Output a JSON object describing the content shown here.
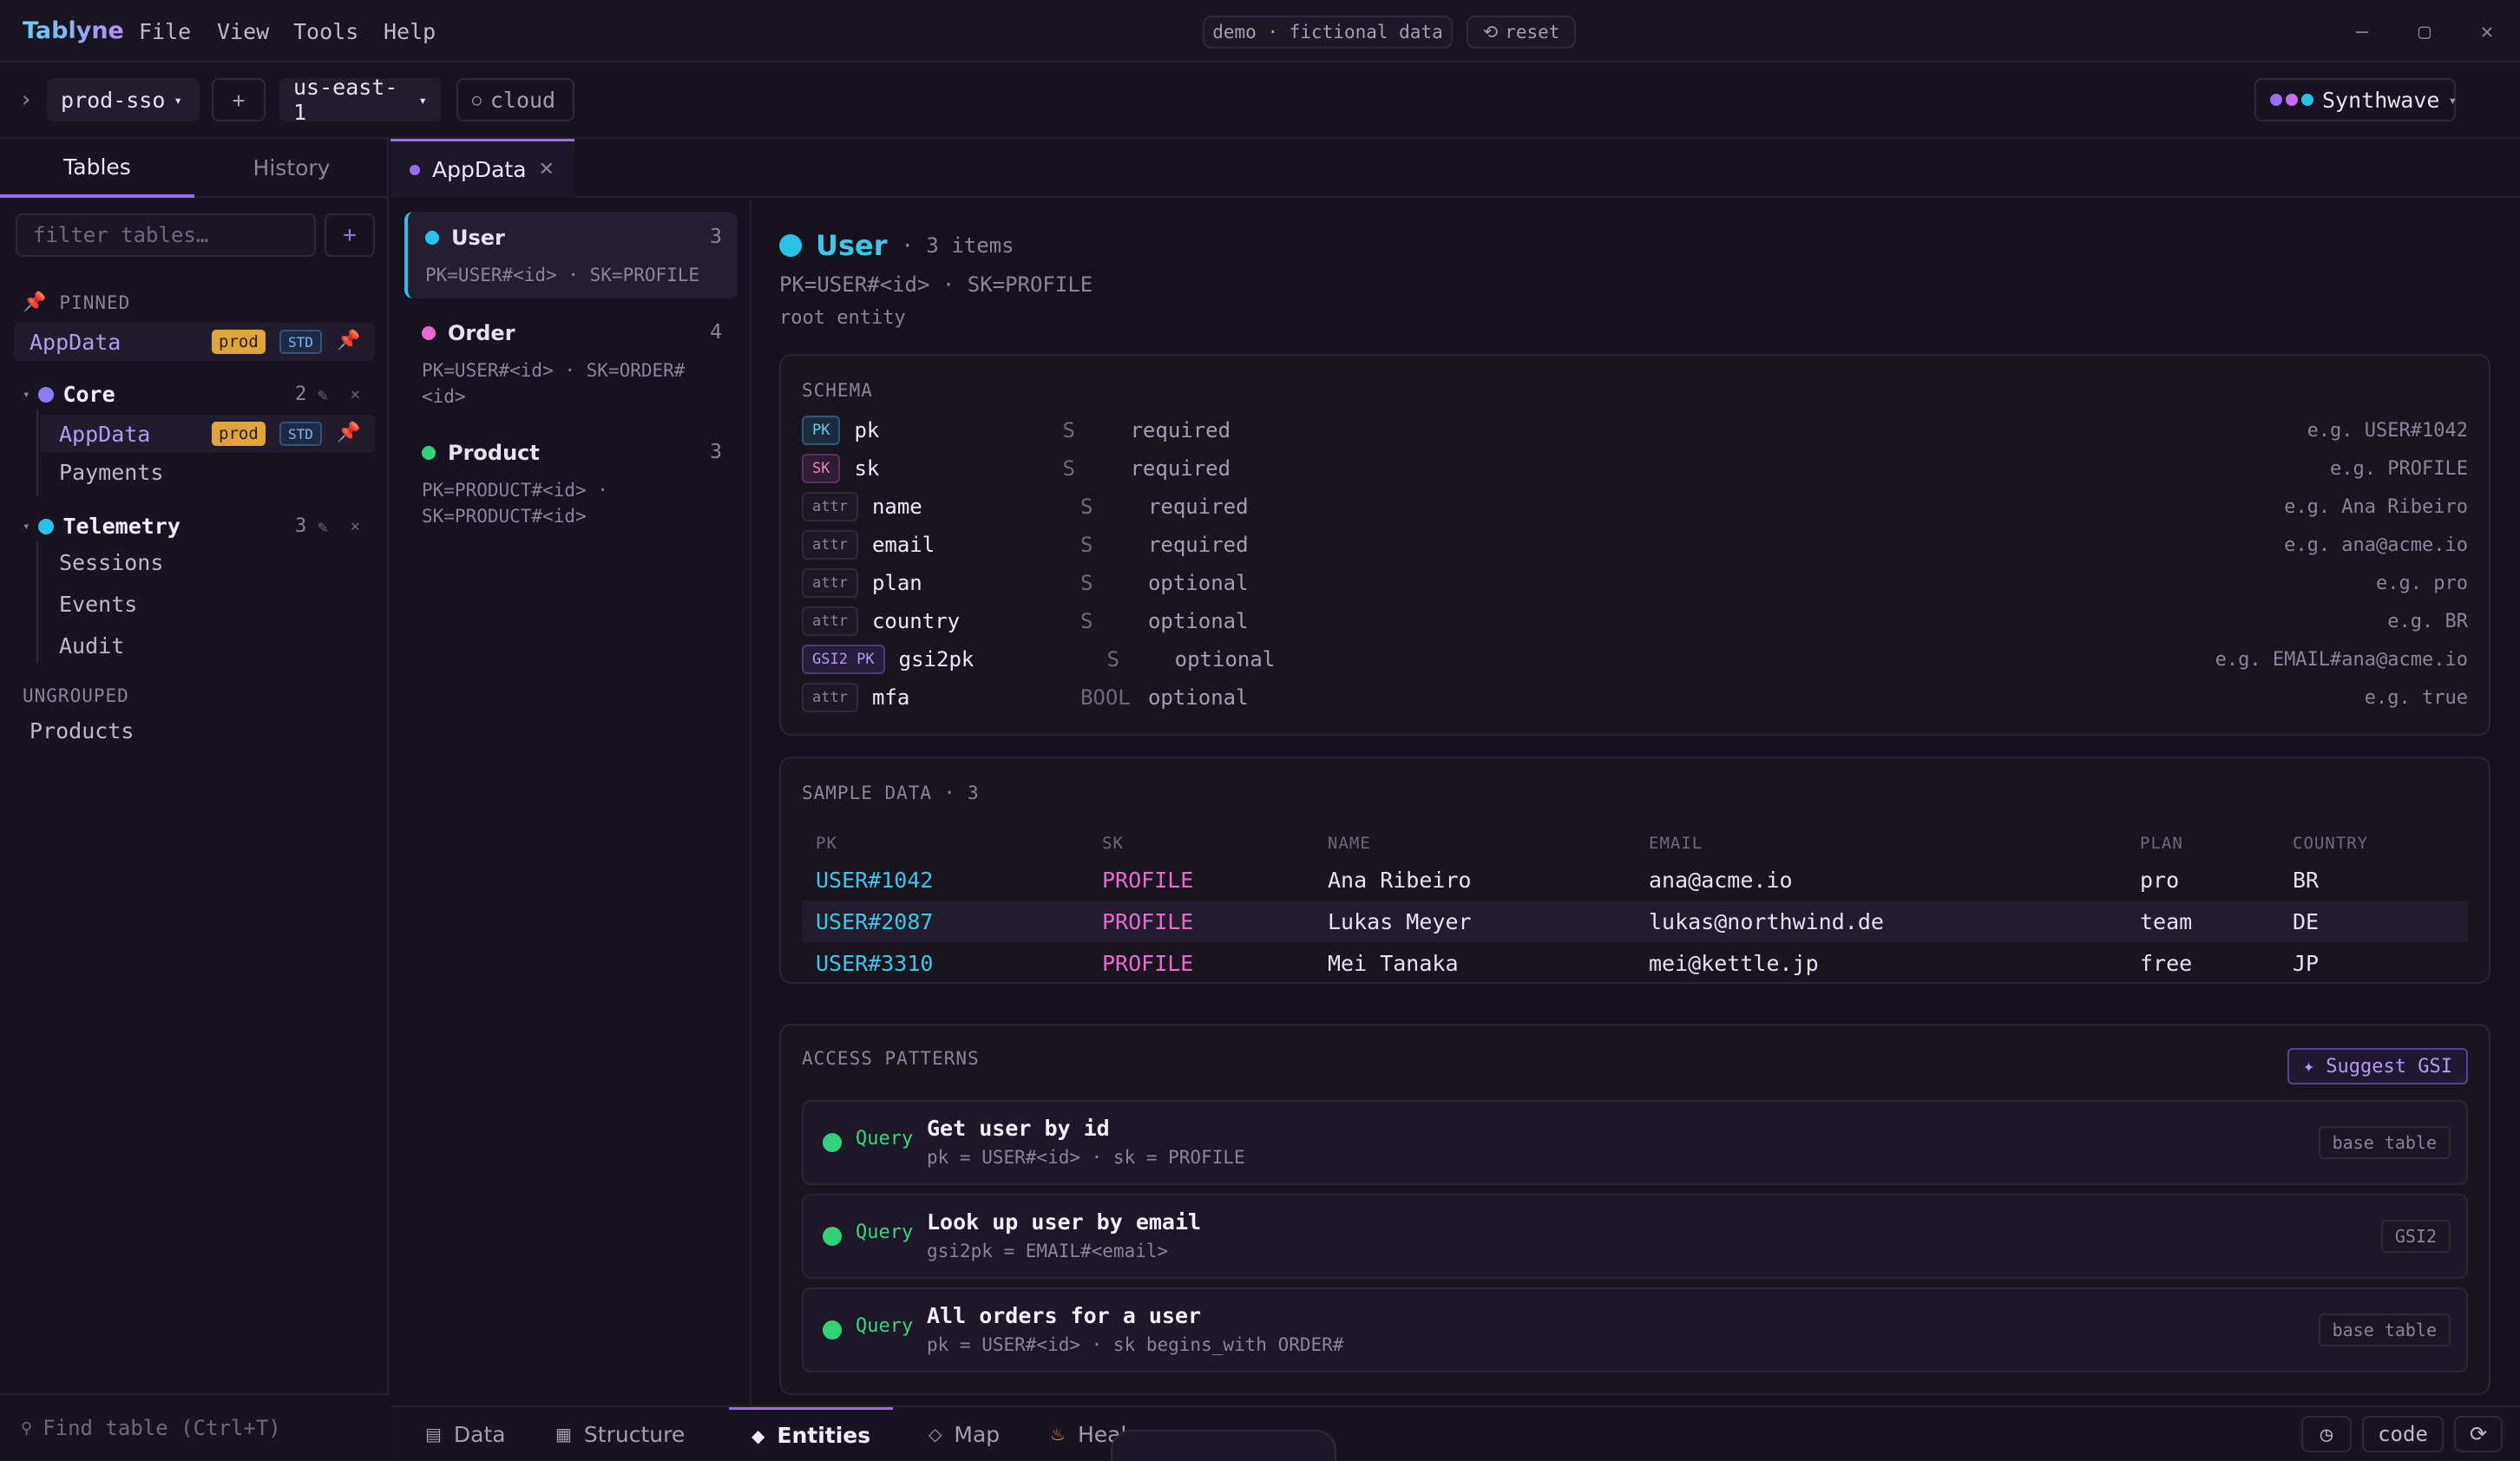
{
  "app": {
    "name": "Tablyne",
    "menu": [
      "File",
      "View",
      "Tools",
      "Help"
    ],
    "demo_badge": "demo · fictional data",
    "reset_label": "reset"
  },
  "toolbar": {
    "profile": "prod-sso",
    "add": "+",
    "region": "us-east-1",
    "mode": "cloud",
    "theme": "Synthwave"
  },
  "sidebar": {
    "tabs": [
      "Tables",
      "History"
    ],
    "filter_placeholder": "filter tables…",
    "add_label": "+",
    "pinned_label": "PINNED",
    "pinned_item": {
      "name": "AppData",
      "env": "prod",
      "class": "STD"
    },
    "groups": [
      {
        "name": "Core",
        "count": "2",
        "color": "#8b7cf6",
        "items": [
          {
            "name": "AppData",
            "env": "prod",
            "class": "STD"
          },
          {
            "name": "Payments"
          }
        ]
      },
      {
        "name": "Telemetry",
        "count": "3",
        "color": "#29c3e8",
        "items": [
          {
            "name": "Sessions"
          },
          {
            "name": "Events"
          },
          {
            "name": "Audit"
          }
        ]
      }
    ],
    "ungrouped_label": "UNGROUPED",
    "ungrouped": [
      "Products"
    ],
    "find_table": "Find table (Ctrl+T)"
  },
  "tab": {
    "label": "AppData"
  },
  "entities": [
    {
      "name": "User",
      "count": "3",
      "color": "#29c3e8",
      "key": "PK=USER#<id> · SK=PROFILE"
    },
    {
      "name": "Order",
      "count": "4",
      "color": "#e86ad0",
      "key": "PK=USER#<id> · SK=ORDER#<id>"
    },
    {
      "name": "Product",
      "count": "3",
      "color": "#34d17b",
      "key": "PK=PRODUCT#<id> · SK=PRODUCT#<id>"
    }
  ],
  "detail": {
    "name": "User",
    "items": "· 3 items",
    "key": "PK=USER#<id> · SK=PROFILE",
    "desc": "root entity",
    "schema_title": "SCHEMA",
    "schema": [
      {
        "kind": "PK",
        "name": "pk",
        "type": "S",
        "req": "required",
        "example": "e.g. USER#1042"
      },
      {
        "kind": "SK",
        "name": "sk",
        "type": "S",
        "req": "required",
        "example": "e.g. PROFILE"
      },
      {
        "kind": "attr",
        "name": "name",
        "type": "S",
        "req": "required",
        "example": "e.g. Ana Ribeiro"
      },
      {
        "kind": "attr",
        "name": "email",
        "type": "S",
        "req": "required",
        "example": "e.g. ana@acme.io"
      },
      {
        "kind": "attr",
        "name": "plan",
        "type": "S",
        "req": "optional",
        "example": "e.g. pro"
      },
      {
        "kind": "attr",
        "name": "country",
        "type": "S",
        "req": "optional",
        "example": "e.g. BR"
      },
      {
        "kind": "GSI2 PK",
        "name": "gsi2pk",
        "type": "S",
        "req": "optional",
        "example": "e.g. EMAIL#ana@acme.io"
      },
      {
        "kind": "attr",
        "name": "mfa",
        "type": "BOOL",
        "req": "optional",
        "example": "e.g. true"
      }
    ],
    "sample_title": "SAMPLE DATA · 3",
    "sample_columns": [
      "PK",
      "SK",
      "NAME",
      "EMAIL",
      "PLAN",
      "COUNTRY"
    ],
    "sample_rows": [
      [
        "USER#1042",
        "PROFILE",
        "Ana Ribeiro",
        "ana@acme.io",
        "pro",
        "BR"
      ],
      [
        "USER#2087",
        "PROFILE",
        "Lukas Meyer",
        "lukas@northwind.de",
        "team",
        "DE"
      ],
      [
        "USER#3310",
        "PROFILE",
        "Mei Tanaka",
        "mei@kettle.jp",
        "free",
        "JP"
      ]
    ],
    "access_title": "ACCESS PATTERNS",
    "suggest_label": "✦ Suggest GSI",
    "access": [
      {
        "op": "Query",
        "title": "Get user by id",
        "expr": "pk = USER#<id> · sk = PROFILE",
        "index": "base table"
      },
      {
        "op": "Query",
        "title": "Look up user by email",
        "expr": "gsi2pk = EMAIL#<email>",
        "index": "GSI2"
      },
      {
        "op": "Query",
        "title": "All orders for a user",
        "expr": "pk = USER#<id> · sk begins_with ORDER#",
        "index": "base table"
      }
    ]
  },
  "bottom_tabs": [
    "Data",
    "Structure",
    "Entities",
    "Map",
    "Heal"
  ],
  "bottom_right": {
    "code": "code"
  },
  "colors": {
    "accent": "#9a6cf0",
    "pk": "#3cc7e8",
    "sk": "#e86ad0",
    "ok": "#34d17b",
    "prod": "#e0a43a"
  }
}
